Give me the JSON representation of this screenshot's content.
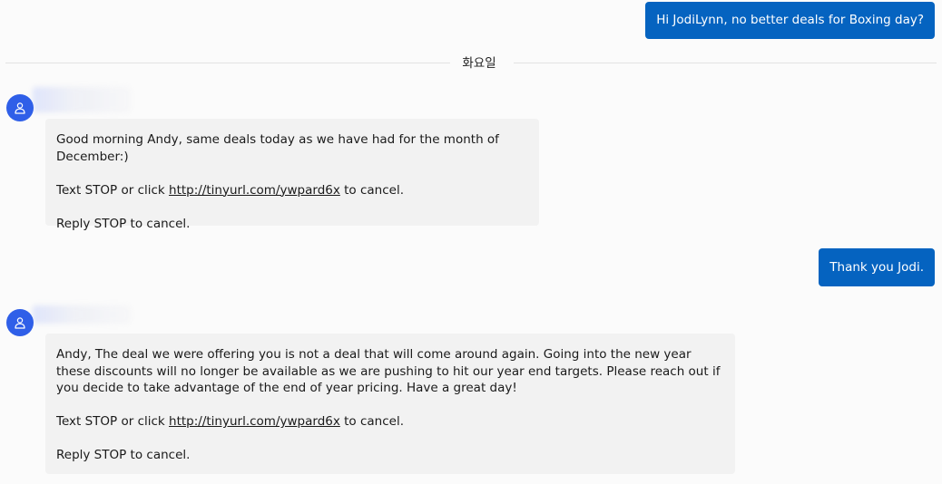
{
  "messages": {
    "outgoing_1": "Hi JodiLynn, no better deals for Boxing day?",
    "day_divider": "화요일",
    "incoming_1": {
      "line1": "Good morning Andy, same deals today as we have had for the month of December:)",
      "stop_prefix": "Text STOP or click ",
      "link": "http://tinyurl.com/ywpard6x",
      "stop_suffix": " to cancel.",
      "reply": "Reply STOP to cancel."
    },
    "outgoing_2": "Thank you Jodi.",
    "incoming_2": {
      "body": "Andy, The deal we were offering you is not a deal that will come around again. Going into the new year these discounts will no longer be available as we are pushing to hit our year end targets. Please reach out if you decide to take advantage of the end of year pricing. Have a great day!",
      "stop_prefix": "Text STOP or click ",
      "link": "http://tinyurl.com/ywpard6x",
      "stop_suffix": " to cancel.",
      "reply": "Reply STOP to cancel."
    }
  },
  "colors": {
    "outgoing_bubble": "#0563c0",
    "incoming_bubble": "#f2f2f2",
    "avatar": "#2f5fe8"
  },
  "icons": {
    "avatar": "person-icon"
  }
}
